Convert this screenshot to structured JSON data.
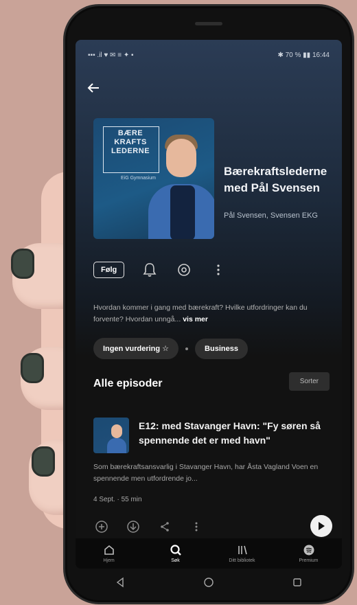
{
  "status_bar": {
    "left": "▪▪▪ .il ♥ ✉ ≡ ✦ ▪",
    "right": "✱ 70 % ▮▮ 16:44"
  },
  "podcast": {
    "cover_text": "BÆRE KRAFTS LEDERNE",
    "cover_sub": "EiG Gymnasium",
    "title": "Bærekraftslederne med Pål Svensen",
    "author": "Pål Svensen, Svensen EKG"
  },
  "actions": {
    "follow_label": "Følg"
  },
  "description": {
    "text": "Hvordan kommer i gang med bærekraft? Hvilke utfordringer kan du forvente? Hvordan unngå...",
    "more_label": "vis mer"
  },
  "chips": {
    "rating": "Ingen vurdering ☆",
    "category": "Business"
  },
  "episodes": {
    "section_title": "Alle episoder",
    "sort_label": "Sorter",
    "item": {
      "title": "E12: med Stavanger Havn: \"Fy søren så spennende det er med havn\"",
      "description": "Som bærekraftsansvarlig i Stavanger Havn, har Åsta Vagland Voen en spennende men utfordrende jo...",
      "meta": "4 Sept. · 55 min"
    }
  },
  "tabs": [
    {
      "label": "Hjem",
      "icon": "home-icon"
    },
    {
      "label": "Søk",
      "icon": "search-icon"
    },
    {
      "label": "Ditt bibliotek",
      "icon": "library-icon"
    },
    {
      "label": "Premium",
      "icon": "spotify-icon"
    }
  ]
}
